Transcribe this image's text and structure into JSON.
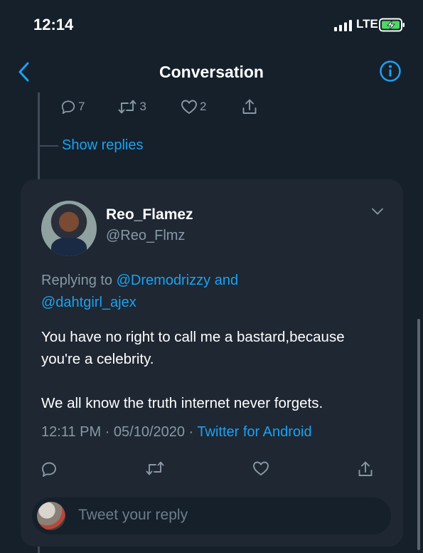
{
  "status_bar": {
    "time": "12:14",
    "network": "LTE"
  },
  "nav": {
    "title": "Conversation"
  },
  "previous_tweet": {
    "reply_count": "7",
    "retweet_count": "3",
    "like_count": "2",
    "show_replies_label": "Show replies"
  },
  "tweet": {
    "display_name": "Reo_Flamez",
    "handle": "@Reo_Flmz",
    "replying_prefix": "Replying to ",
    "mention_1": "@Dremodrizzy",
    "replying_and": " and",
    "mention_2": "@dahtgirl_ajex",
    "body_line_1": "You have no right to call me a bastard,because you're a celebrity.",
    "body_line_2": "We all know the truth internet never forgets.",
    "timestamp": "12:11 PM · 05/10/2020 · ",
    "source": "Twitter for Android"
  },
  "reply_box": {
    "placeholder": "Tweet your reply"
  },
  "colors": {
    "background": "#15202b",
    "card": "#1e2732",
    "accent": "#1da1f2",
    "muted": "#8899a6"
  },
  "icons": [
    "back-icon",
    "info-icon",
    "reply-icon",
    "retweet-icon",
    "like-icon",
    "share-icon",
    "chevron-down-icon"
  ]
}
